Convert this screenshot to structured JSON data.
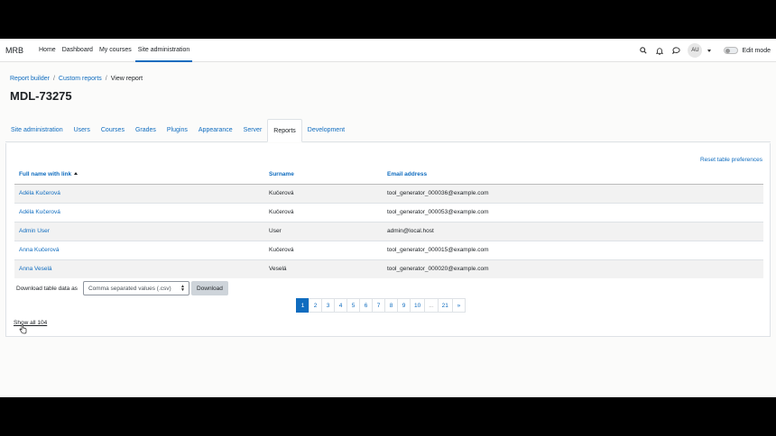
{
  "navbar": {
    "brand": "MRB",
    "links": [
      "Home",
      "Dashboard",
      "My courses",
      "Site administration"
    ],
    "active_link": "Site administration",
    "avatar_initials": "AU",
    "edit_mode_label": "Edit mode",
    "icons": [
      "search-icon",
      "bell-icon",
      "chat-icon"
    ]
  },
  "breadcrumb": [
    "Report builder",
    "Custom reports",
    "View report"
  ],
  "page_title": "MDL-73275",
  "secondary_nav": {
    "tabs": [
      "Site administration",
      "Users",
      "Courses",
      "Grades",
      "Plugins",
      "Appearance",
      "Server",
      "Reports",
      "Development"
    ],
    "active": "Reports"
  },
  "report": {
    "reset_label": "Reset table preferences",
    "columns": [
      "Full name with link",
      "Surname",
      "Email address"
    ],
    "sorted_column": "Full name with link",
    "rows": [
      {
        "name": "Adéla Kučerová",
        "surname": "Kučerová",
        "email": "tool_generator_000036@example.com"
      },
      {
        "name": "Adéla Kučerová",
        "surname": "Kučerová",
        "email": "tool_generator_000053@example.com"
      },
      {
        "name": "Admin User",
        "surname": "User",
        "email": "admin@local.host"
      },
      {
        "name": "Anna Kučerová",
        "surname": "Kučerová",
        "email": "tool_generator_000015@example.com"
      },
      {
        "name": "Anna Veselá",
        "surname": "Veselá",
        "email": "tool_generator_000020@example.com"
      }
    ],
    "download_label": "Download table data as",
    "format_selected": "Comma separated values (.csv)",
    "download_button": "Download",
    "pages": [
      "1",
      "2",
      "3",
      "4",
      "5",
      "6",
      "7",
      "8",
      "9",
      "10",
      "...",
      "21",
      "»"
    ],
    "current_page": "1",
    "show_all_label": "Show all 104"
  },
  "colors": {
    "accent": "#0f6cbf",
    "row_stripe": "#f2f2f2"
  }
}
